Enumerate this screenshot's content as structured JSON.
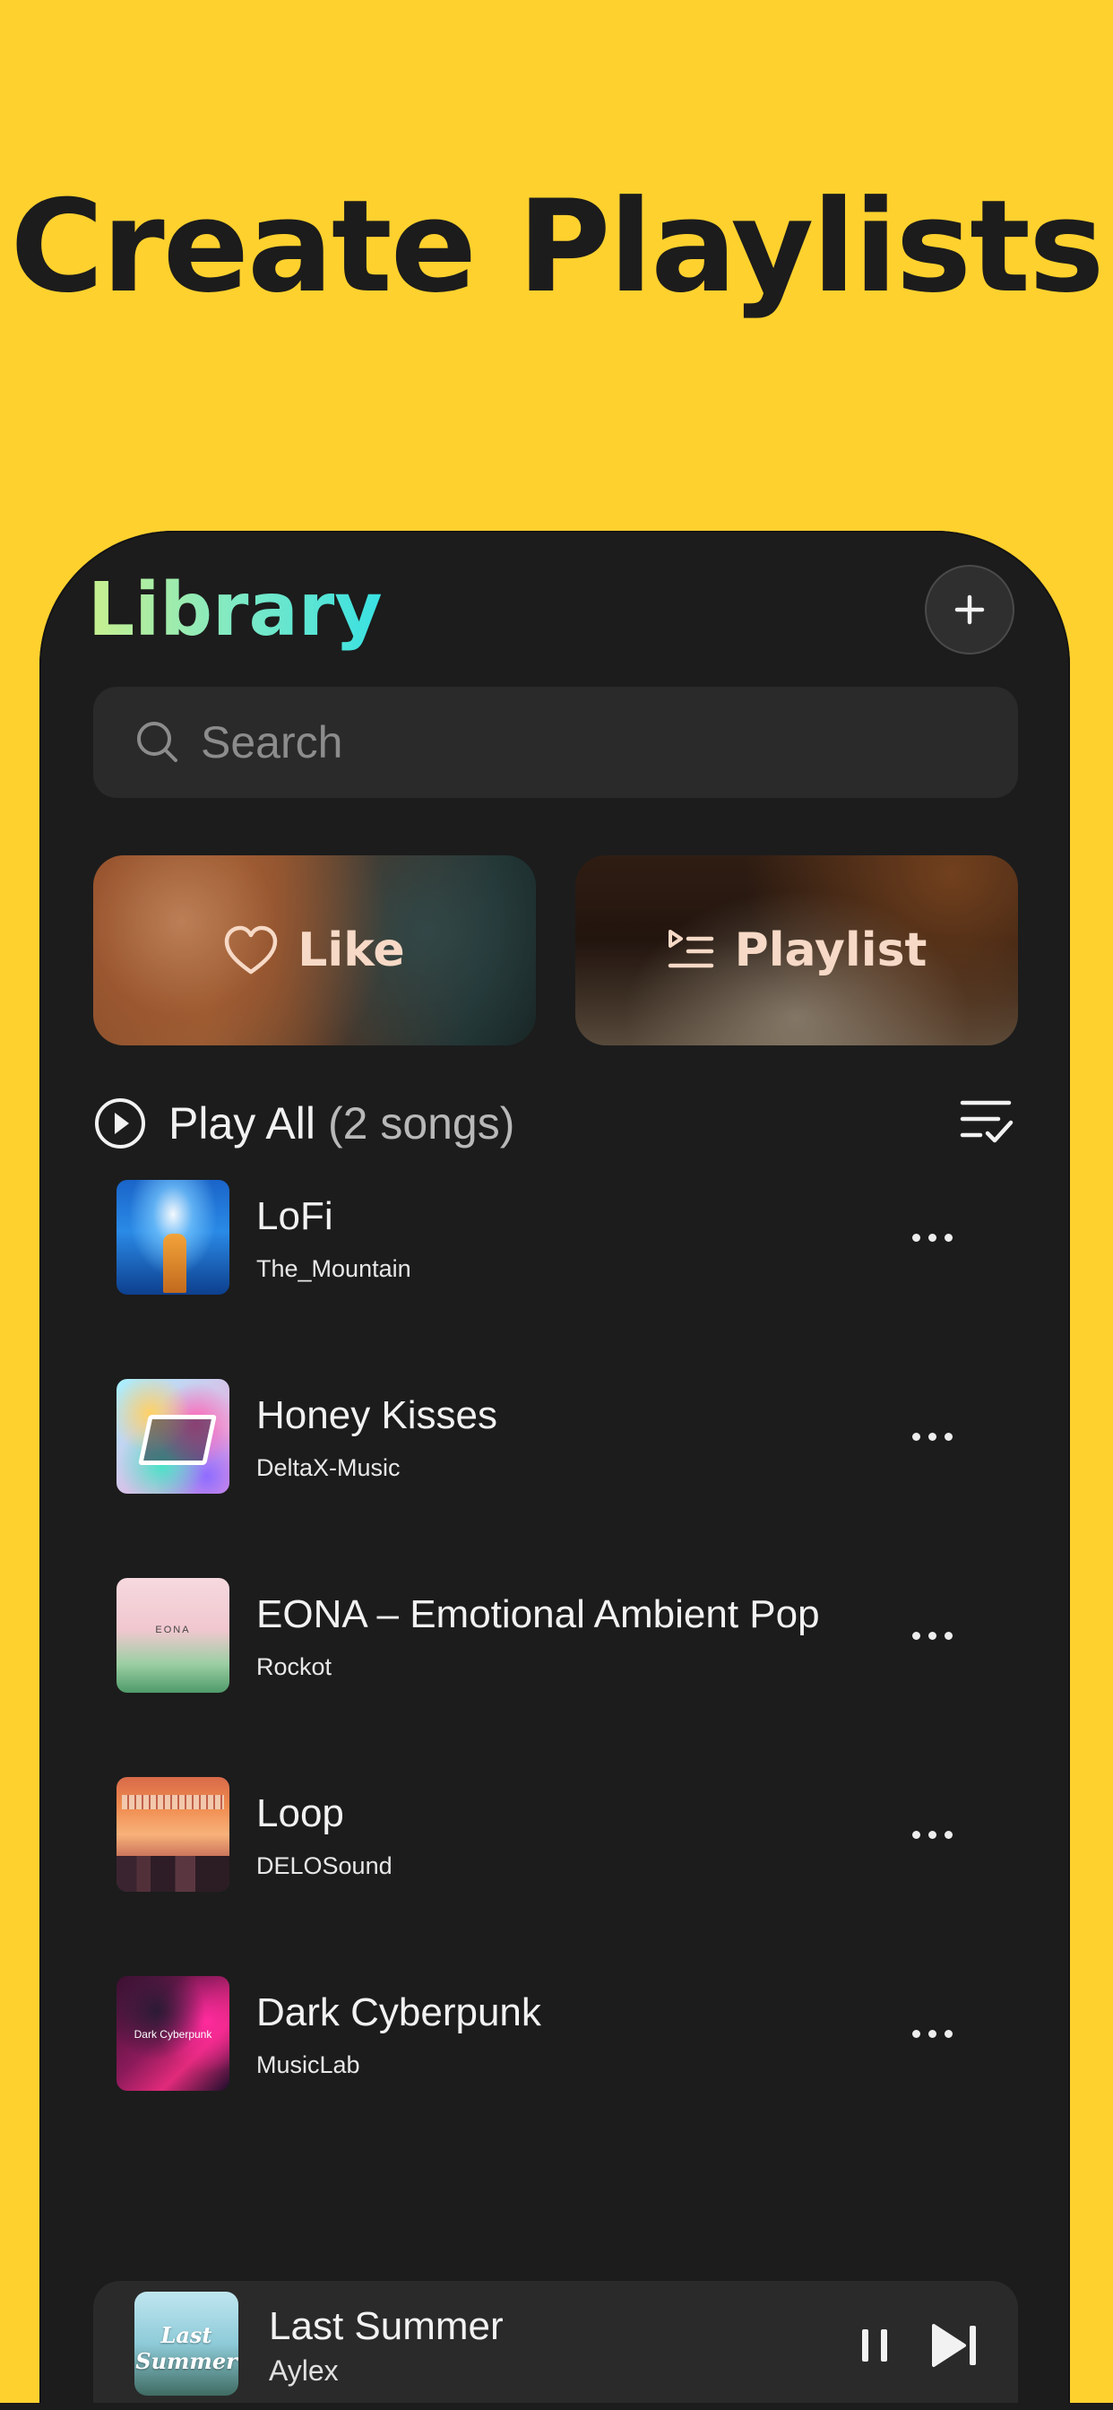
{
  "hero": {
    "title": "Create Playlists"
  },
  "library": {
    "title": "Library",
    "search_placeholder": "Search",
    "cards": [
      {
        "label": "Like",
        "icon": "heart-icon"
      },
      {
        "label": "Playlist",
        "icon": "playlist-icon"
      }
    ],
    "play_all": {
      "label": "Play All",
      "count": "(2 songs)"
    },
    "songs": [
      {
        "title": "LoFi",
        "artist": "The_Mountain"
      },
      {
        "title": "Honey Kisses",
        "artist": "DeltaX-Music"
      },
      {
        "title": "EONA – Emotional Ambient Pop",
        "artist": "Rockot",
        "cover_text": "EONA"
      },
      {
        "title": "Loop",
        "artist": "DELOSound"
      },
      {
        "title": "Dark Cyberpunk",
        "artist": "MusicLab",
        "cover_text": "Dark Cyberpunk"
      }
    ]
  },
  "player": {
    "title": "Last Summer",
    "artist": "Aylex",
    "cover_text": "Last Summer"
  },
  "colors": {
    "background": "#FFD12E",
    "panel": "#1C1C1C",
    "title_gradient": [
      "#C9F08E",
      "#38E1E3"
    ]
  }
}
